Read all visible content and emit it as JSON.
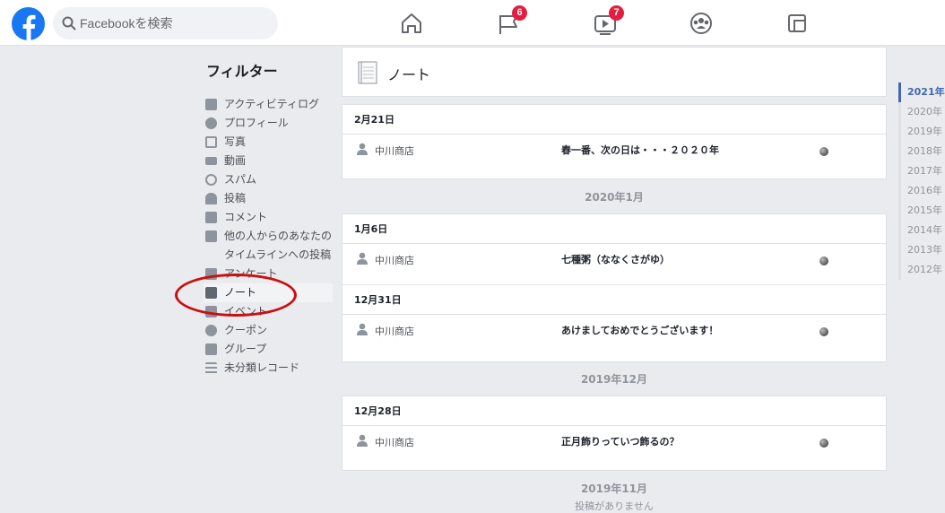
{
  "topbar": {
    "search_placeholder": "Facebookを検索",
    "badges": {
      "pages": "6",
      "watch": "7"
    }
  },
  "filters": {
    "title": "フィルター",
    "items": [
      {
        "label": "アクティビティログ",
        "icon": "facebook-square-icon"
      },
      {
        "label": "プロフィール",
        "icon": "info-icon"
      },
      {
        "label": "写真",
        "icon": "photos-icon"
      },
      {
        "label": "動画",
        "icon": "video-camera-icon"
      },
      {
        "label": "スパム",
        "icon": "ban-icon"
      },
      {
        "label": "投稿",
        "icon": "person-icon"
      },
      {
        "label": "コメント",
        "icon": "comment-icon"
      },
      {
        "label_1": "他の人からのあなたの",
        "label_2": "タイムラインへの投稿",
        "icon": "speech-icon"
      },
      {
        "label": "アンケート",
        "icon": "poll-icon"
      },
      {
        "label": "ノート",
        "icon": "note-icon",
        "active": true
      },
      {
        "label": "イベント",
        "icon": "calendar-icon"
      },
      {
        "label": "クーポン",
        "icon": "gear-icon"
      },
      {
        "label": "グループ",
        "icon": "group-icon"
      },
      {
        "label": "未分類レコード",
        "icon": "list-icon"
      }
    ]
  },
  "main": {
    "title": "ノート",
    "sections": [
      {
        "days": [
          {
            "date": "2月21日",
            "entries": [
              {
                "author": "中川商店",
                "title": "春一番、次の日は・・・２０２０年"
              }
            ]
          }
        ]
      },
      {
        "month": "2020年1月",
        "days": [
          {
            "date": "1月6日",
            "entries": [
              {
                "author": "中川商店",
                "title": "七種粥（ななくさがゆ）"
              }
            ]
          },
          {
            "date": "12月31日",
            "entries": [
              {
                "author": "中川商店",
                "title": "あけましておめでとうございます！"
              }
            ]
          }
        ]
      },
      {
        "month": "2019年12月",
        "days": [
          {
            "date": "12月28日",
            "entries": [
              {
                "author": "中川商店",
                "title": "正月飾りっていつ飾るの？"
              }
            ]
          }
        ]
      },
      {
        "month": "2019年11月",
        "note": "投稿がありません"
      }
    ]
  },
  "years": [
    "2021年",
    "2020年",
    "2019年",
    "2018年",
    "2017年",
    "2016年",
    "2015年",
    "2014年",
    "2013年",
    "2012年"
  ],
  "active_year": "2021年",
  "colors": {
    "brand": "#1877f2",
    "badge": "#e41e3f",
    "link": "#4267b2",
    "highlight_ring": "#cc0e0e"
  }
}
